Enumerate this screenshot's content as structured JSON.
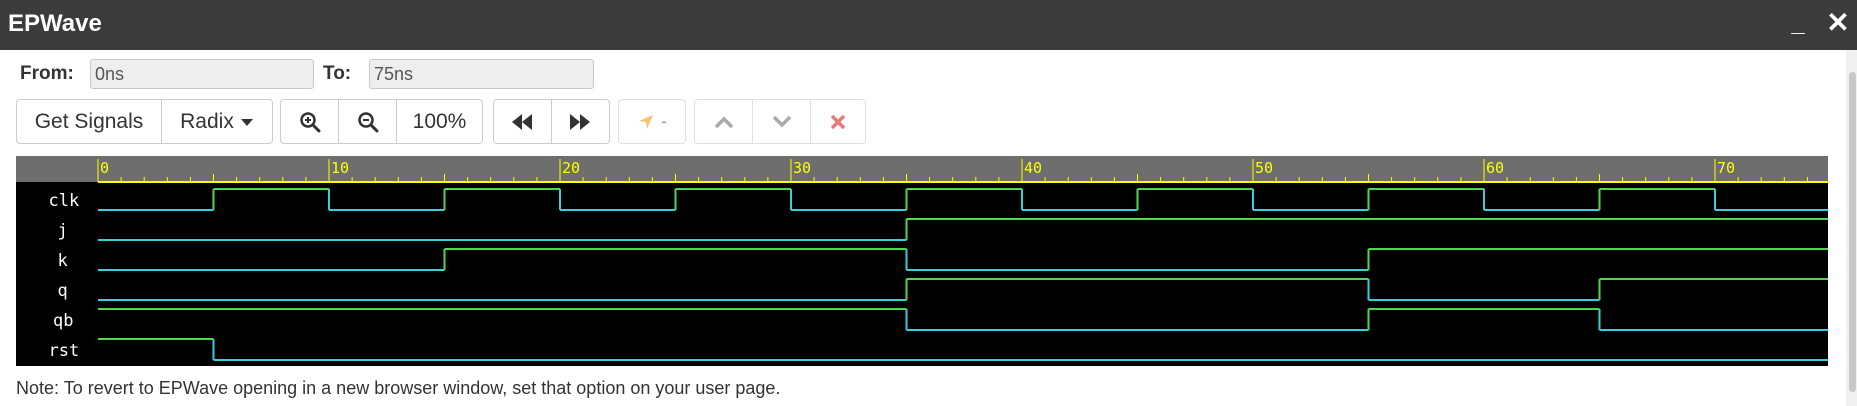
{
  "window": {
    "title": "EPWave",
    "minimize_glyph": "_",
    "close_glyph": "✕"
  },
  "range": {
    "from_label": "From:",
    "from_value": "0ns",
    "to_label": "To:",
    "to_value": "75ns"
  },
  "toolbar": {
    "get_signals_label": "Get Signals",
    "radix_label": "Radix",
    "zoom_level": "100%",
    "cursor_label": "-",
    "icons": [
      "zoom-in-icon",
      "zoom-out-icon",
      "rewind-icon",
      "fast-forward-icon",
      "cursor-arrow-icon",
      "chevron-up-icon",
      "chevron-down-icon",
      "close-icon"
    ]
  },
  "waveform": {
    "time_unit": "ns",
    "time_range": [
      0,
      75
    ],
    "tick_labels": [
      "0",
      "10",
      "20",
      "30",
      "40",
      "50",
      "60",
      "70"
    ],
    "colors": {
      "high": "#4ed84e",
      "low": "#36d0d8",
      "ruler": "#ffff00",
      "ruler_bg": "#6e6e6e",
      "background": "#000000"
    },
    "signals": [
      {
        "name": "clk",
        "initial": 0,
        "transitions": [
          [
            5,
            1
          ],
          [
            10,
            0
          ],
          [
            15,
            1
          ],
          [
            20,
            0
          ],
          [
            25,
            1
          ],
          [
            30,
            0
          ],
          [
            35,
            1
          ],
          [
            40,
            0
          ],
          [
            45,
            1
          ],
          [
            50,
            0
          ],
          [
            55,
            1
          ],
          [
            60,
            0
          ],
          [
            65,
            1
          ],
          [
            70,
            0
          ]
        ]
      },
      {
        "name": "j",
        "initial": 0,
        "transitions": [
          [
            35,
            1
          ]
        ]
      },
      {
        "name": "k",
        "initial": 0,
        "transitions": [
          [
            15,
            1
          ],
          [
            35,
            0
          ],
          [
            55,
            1
          ]
        ]
      },
      {
        "name": "q",
        "initial": 0,
        "transitions": [
          [
            35,
            1
          ],
          [
            55,
            0
          ],
          [
            65,
            1
          ]
        ]
      },
      {
        "name": "qb",
        "initial": 1,
        "transitions": [
          [
            35,
            0
          ],
          [
            55,
            1
          ],
          [
            65,
            0
          ]
        ]
      },
      {
        "name": "rst",
        "initial": 1,
        "transitions": [
          [
            5,
            0
          ]
        ]
      }
    ]
  },
  "note": "Note: To revert to EPWave opening in a new browser window, set that option on your user page."
}
